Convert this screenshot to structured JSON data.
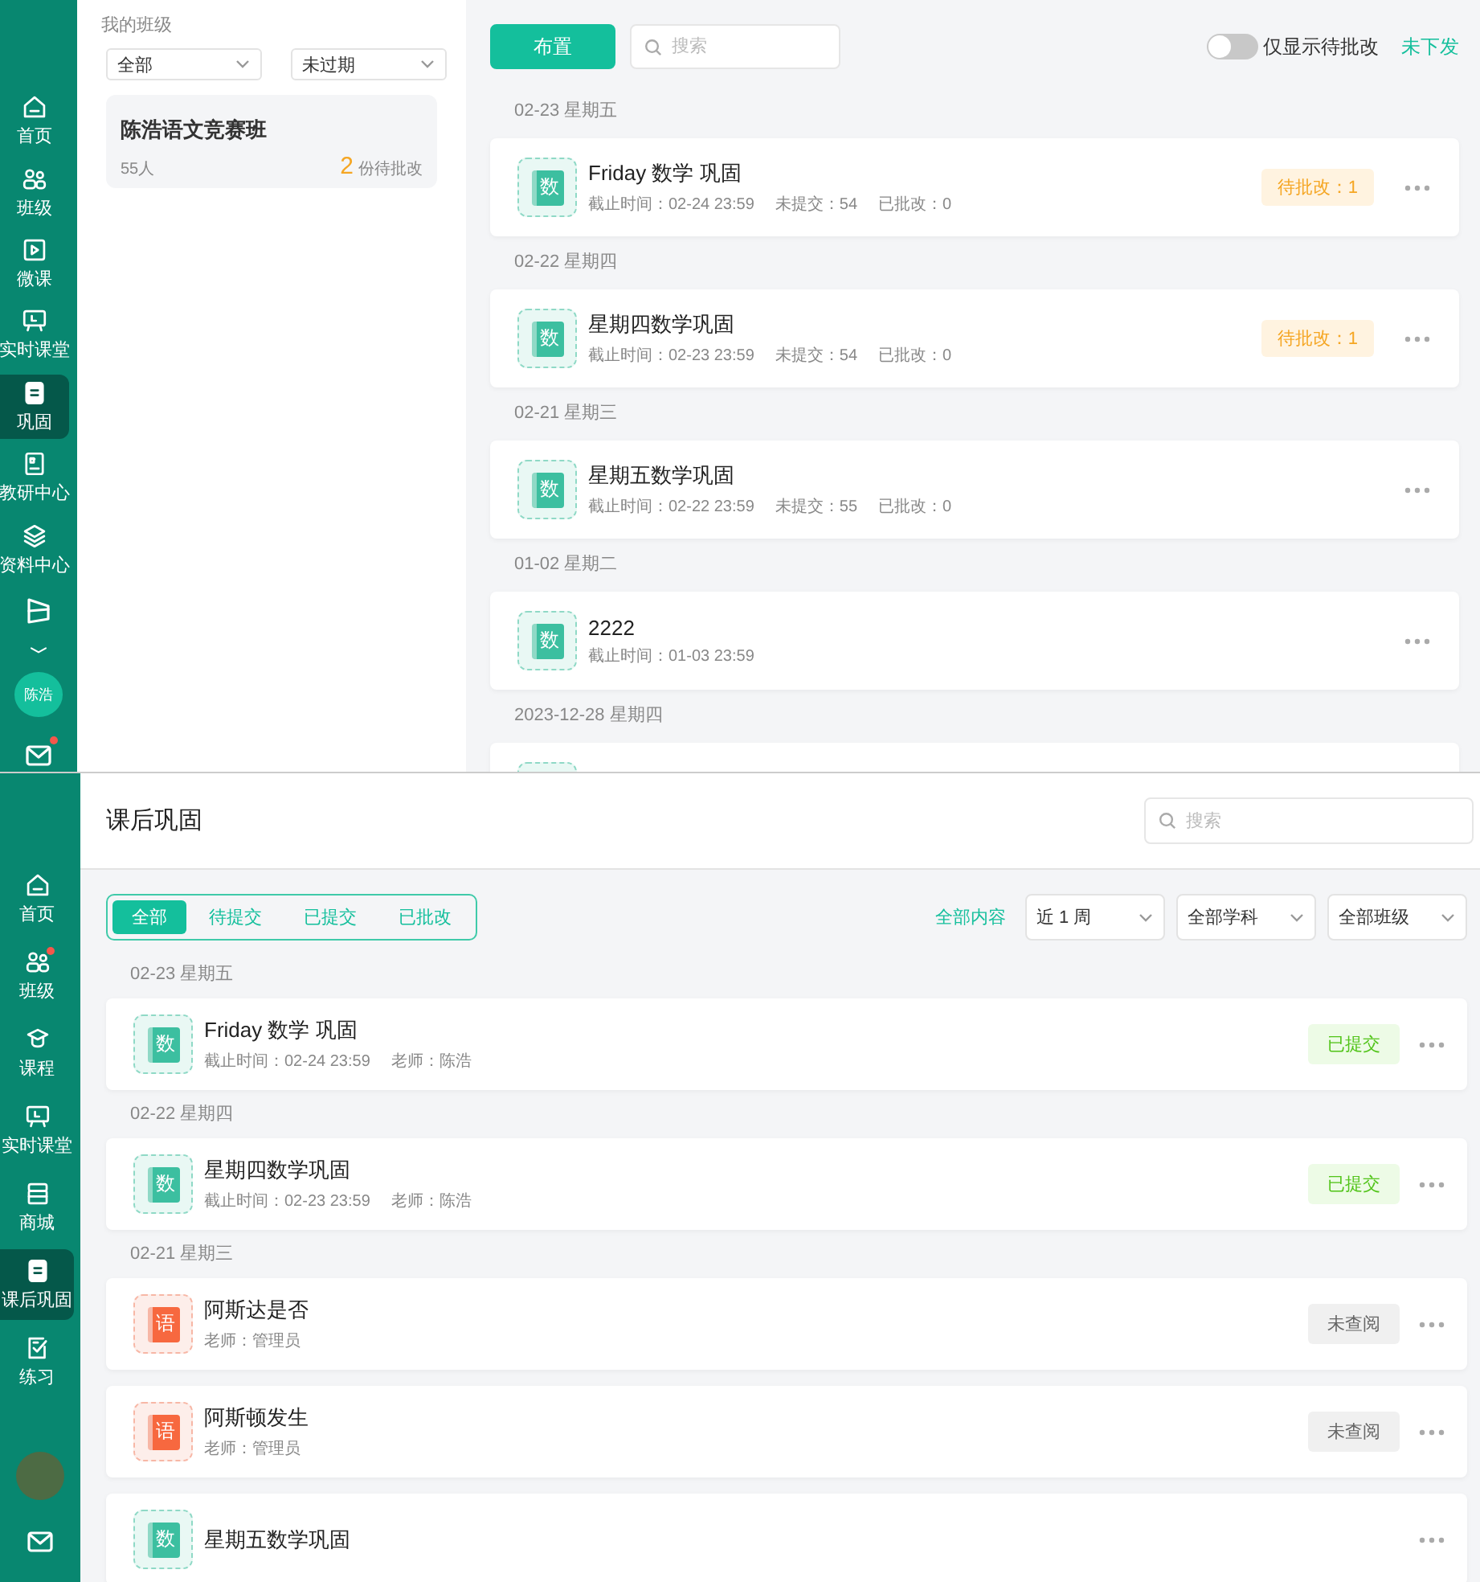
{
  "top_view": {
    "sidebar": {
      "items": [
        {
          "label": "首页",
          "selected": false
        },
        {
          "label": "班级",
          "selected": false
        },
        {
          "label": "微课",
          "selected": false
        },
        {
          "label": "实时课堂",
          "selected": false
        },
        {
          "label": "巩固",
          "selected": true
        },
        {
          "label": "教研中心",
          "selected": false
        },
        {
          "label": "资料中心",
          "selected": false
        }
      ],
      "avatar_text": "陈浩",
      "mail_notification": true
    },
    "class_panel": {
      "title": "我的班级",
      "filters": [
        {
          "value": "全部"
        },
        {
          "value": "未过期"
        }
      ],
      "classes": [
        {
          "name": "陈浩语文竞赛班",
          "student_count": "55人",
          "pending_count": "2",
          "pending_label": "份待批改"
        }
      ]
    },
    "toolbar": {
      "assign_button": "布置",
      "search": {
        "placeholder": "搜索"
      },
      "toggle": {
        "label": "仅显示待批改",
        "on": false
      },
      "link": "未下发"
    },
    "groups": [
      {
        "date": "02-23 星期五",
        "items": [
          {
            "kind": "math",
            "glyph": "数",
            "title": "Friday 数学 巩固",
            "meta": [
              "截止时间：02-24 23:59",
              "未提交：54",
              "已批改：0"
            ],
            "status": {
              "kind": "pending",
              "text": "待批改：1"
            }
          }
        ]
      },
      {
        "date": "02-22 星期四",
        "items": [
          {
            "kind": "math",
            "glyph": "数",
            "title": "星期四数学巩固",
            "meta": [
              "截止时间：02-23 23:59",
              "未提交：54",
              "已批改：0"
            ],
            "status": {
              "kind": "pending",
              "text": "待批改：1"
            }
          }
        ]
      },
      {
        "date": "02-21 星期三",
        "items": [
          {
            "kind": "math",
            "glyph": "数",
            "title": "星期五数学巩固",
            "meta": [
              "截止时间：02-22 23:59",
              "未提交：55",
              "已批改：0"
            ]
          }
        ]
      },
      {
        "date": "01-02 星期二",
        "items": [
          {
            "kind": "math",
            "glyph": "数",
            "title": "2222",
            "meta": [
              "截止时间：01-03 23:59"
            ]
          }
        ]
      },
      {
        "date": "2023-12-28 星期四",
        "items": [
          {
            "kind": "math"
          }
        ]
      }
    ]
  },
  "bottom_view": {
    "sidebar": {
      "items": [
        {
          "label": "首页",
          "selected": false,
          "notification": false
        },
        {
          "label": "班级",
          "selected": false,
          "notification": true
        },
        {
          "label": "课程",
          "selected": false,
          "notification": false
        },
        {
          "label": "实时课堂",
          "selected": false,
          "notification": false
        },
        {
          "label": "商城",
          "selected": false,
          "notification": false
        },
        {
          "label": "课后巩固",
          "selected": true,
          "notification": false
        },
        {
          "label": "练习",
          "selected": false,
          "notification": false
        }
      ]
    },
    "header": {
      "title": "课后巩固",
      "search": {
        "placeholder": "搜索"
      }
    },
    "tabs": [
      {
        "label": "全部",
        "selected": true
      },
      {
        "label": "待提交",
        "selected": false
      },
      {
        "label": "已提交",
        "selected": false
      },
      {
        "label": "已批改",
        "selected": false
      }
    ],
    "filters": {
      "link": "全部内容",
      "selects": [
        {
          "value": "近 1 周"
        },
        {
          "value": "全部学科"
        },
        {
          "value": "全部班级"
        }
      ]
    },
    "groups": [
      {
        "date": "02-23 星期五",
        "items": [
          {
            "kind": "math",
            "glyph": "数",
            "title": "Friday 数学 巩固",
            "meta": [
              "截止时间：02-24 23:59",
              "老师：陈浩"
            ],
            "status": {
              "kind": "submitted",
              "text": "已提交"
            }
          }
        ]
      },
      {
        "date": "02-22 星期四",
        "items": [
          {
            "kind": "math",
            "glyph": "数",
            "title": "星期四数学巩固",
            "meta": [
              "截止时间：02-23 23:59",
              "老师：陈浩"
            ],
            "status": {
              "kind": "submitted",
              "text": "已提交"
            }
          }
        ]
      },
      {
        "date": "02-21 星期三",
        "items": [
          {
            "kind": "chinese",
            "glyph": "语",
            "title": "阿斯达是否",
            "meta": [
              "老师：管理员"
            ],
            "status": {
              "kind": "unread",
              "text": "未查阅"
            }
          },
          {
            "kind": "chinese",
            "glyph": "语",
            "title": "阿斯顿发生",
            "meta": [
              "老师：管理员"
            ],
            "status": {
              "kind": "unread",
              "text": "未查阅"
            }
          },
          {
            "kind": "math",
            "glyph": "数",
            "title": "星期五数学巩固"
          }
        ]
      }
    ]
  }
}
